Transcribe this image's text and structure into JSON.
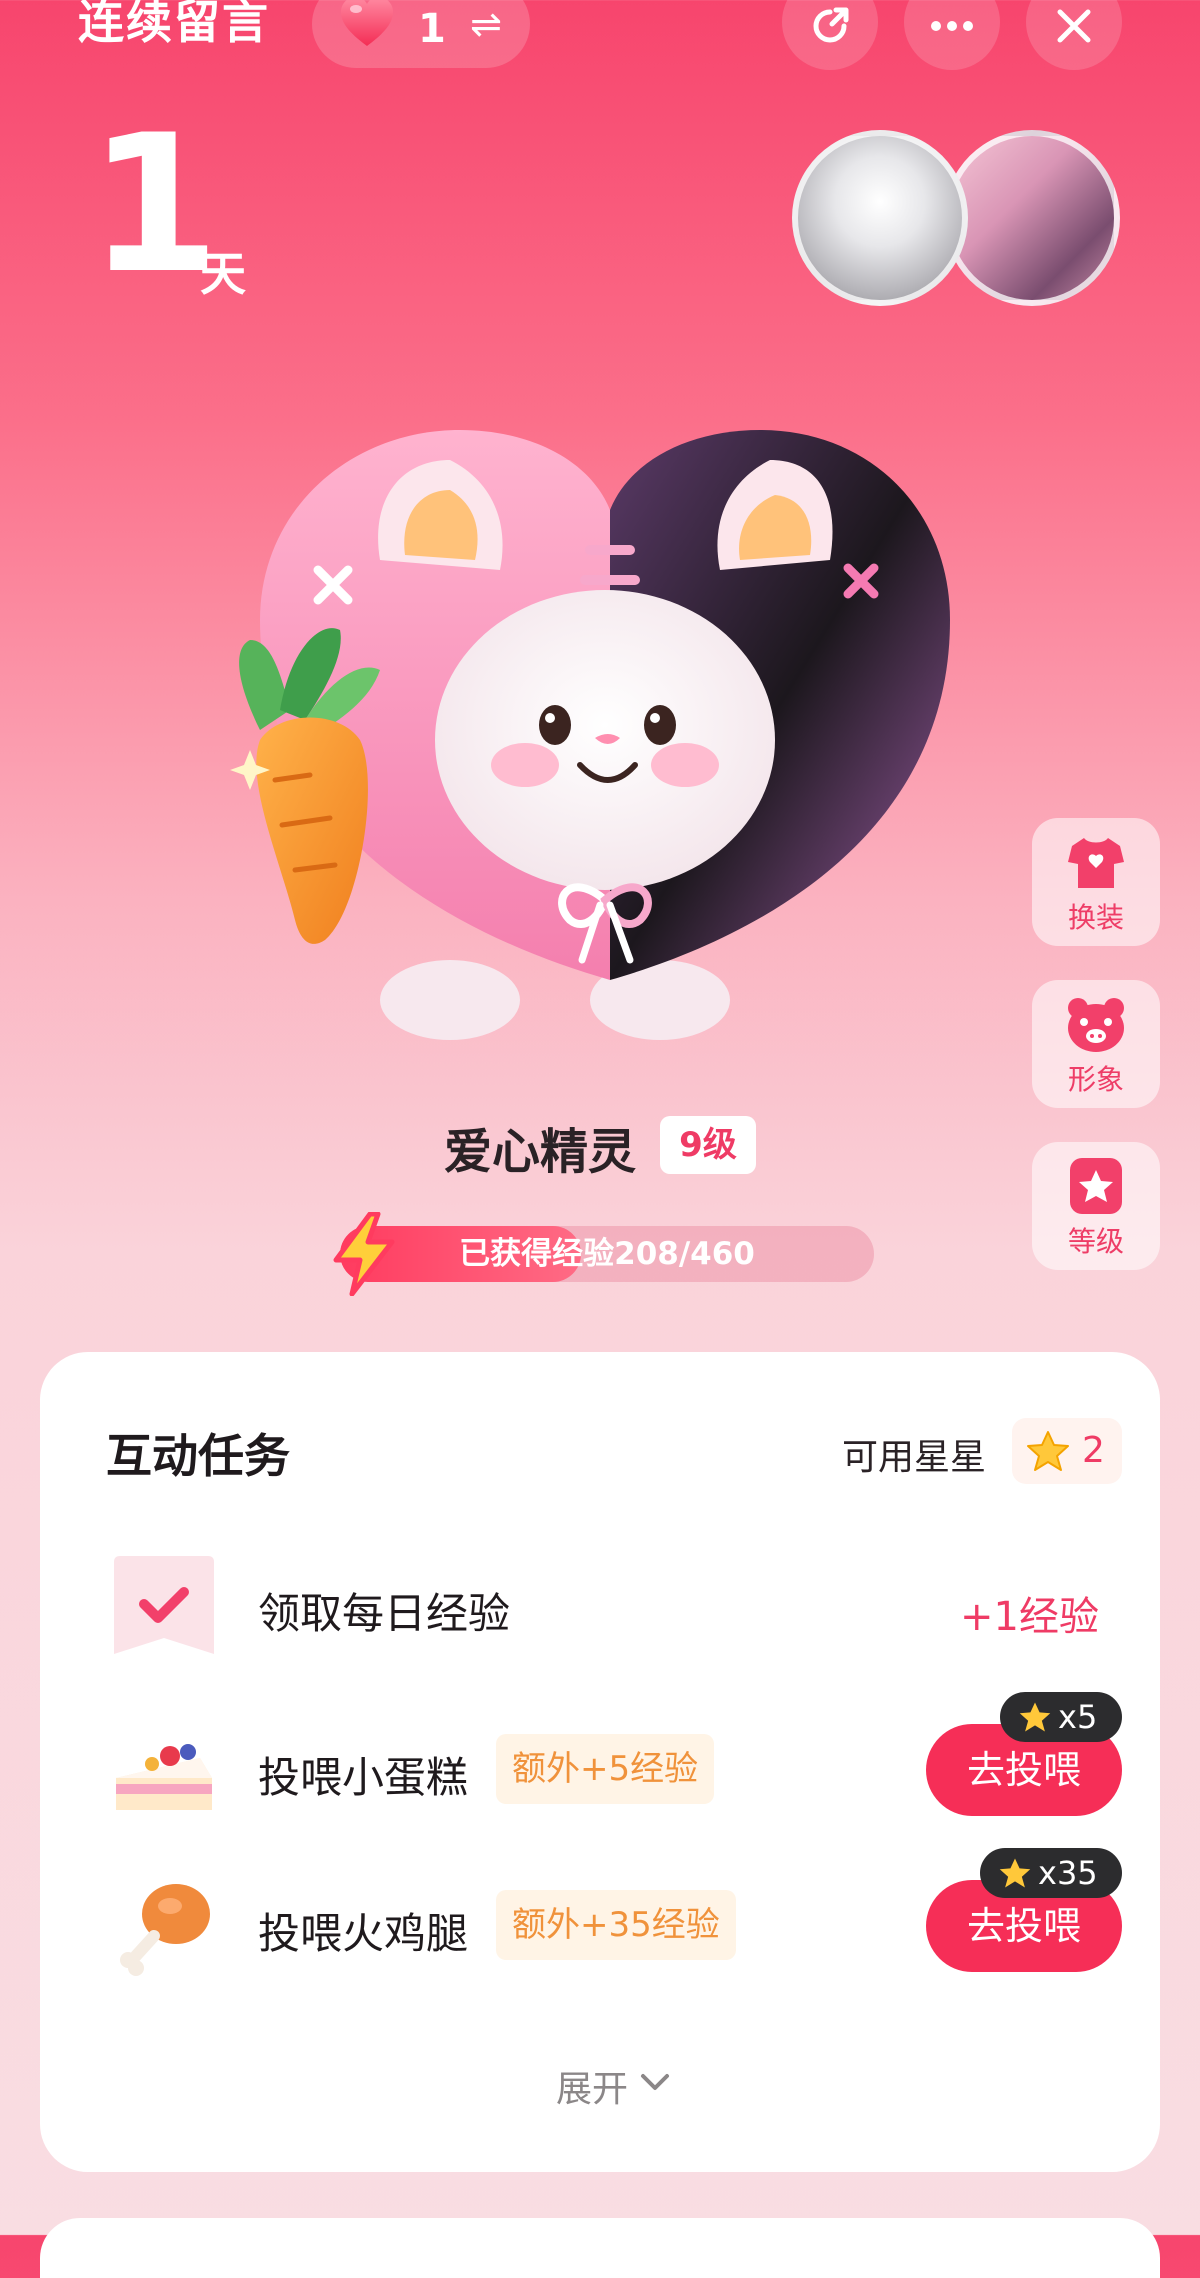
{
  "header": {
    "title": "连续留言",
    "heart_count": "1",
    "swap_symbol": "⇌",
    "share_icon": "share-icon",
    "more_icon": "more-icon",
    "close_icon": "close-icon"
  },
  "streak": {
    "days": "1",
    "unit": "天"
  },
  "side_menu": [
    {
      "label": "换装",
      "icon": "shirt-icon"
    },
    {
      "label": "形象",
      "icon": "pig-face-icon"
    },
    {
      "label": "等级",
      "icon": "star-badge-icon"
    }
  ],
  "mascot": {
    "name": "爱心精灵",
    "level": "9级",
    "exp_text": "已获得经验208/460",
    "exp_current": 208,
    "exp_total": 460
  },
  "tasks_card": {
    "title": "互动任务",
    "stars_label": "可用星星",
    "stars_count": "2",
    "tasks": [
      {
        "label": "领取每日经验",
        "reward": "+1经验",
        "icon": "check-envelope-icon"
      },
      {
        "label": "投喂小蛋糕",
        "bonus": "额外+5经验",
        "button": "去投喂",
        "cost": "x5",
        "icon": "cake-icon"
      },
      {
        "label": "投喂火鸡腿",
        "bonus": "额外+35经验",
        "button": "去投喂",
        "cost": "x35",
        "icon": "drumstick-icon"
      }
    ],
    "expand_label": "展开"
  },
  "colors": {
    "accent": "#f62e57",
    "bonus_text": "#f0923b"
  }
}
